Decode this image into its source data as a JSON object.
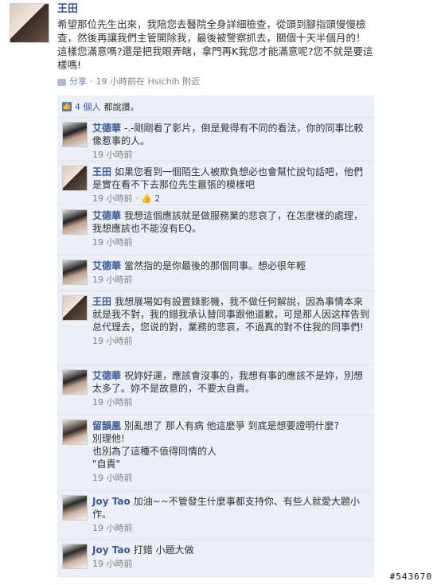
{
  "post": {
    "author": "王田",
    "text": "希望那位先生出來，我陪您去醫院全身詳細檢查，從頭到腳指頭慢慢檢查，然後再讓我們主管開除我，最後被警察抓去，關個十天半個月的！這樣您滿意嗎?還是把我眼弄瞎，拿門再K我您才能滿意呢?您不就是要這樣嗎!",
    "share_label": "分享",
    "time": "19 小時前在 Hsichih 附近"
  },
  "likes": {
    "count_text": "4 個人",
    "suffix": "都說讚。"
  },
  "comments": [
    {
      "author": "艾德華",
      "text": "-.-剛剛看了影片，倒是覺得有不同的看法，你的同事比較像惹事的人。",
      "time": "19 小時前"
    },
    {
      "author": "王田",
      "text": "如果您看到一個陌生人被欺負想必也會幫忙說句話吧，他們是實在看不下去那位先生囂張的模樣吧",
      "time": "19 小時前",
      "likes": "2"
    },
    {
      "author": "艾德華",
      "text": "我想這個應該就是做服務業的悲哀了，在怎麼樣的處理，我想應該也不能沒有EQ。",
      "time": "19 小時前"
    },
    {
      "author": "艾德華",
      "text": "當然指的是你最後的那個同事。想必很年輕",
      "time": "19 小時前"
    },
    {
      "author": "王田",
      "text": "我想展場如有設置錄影機，我不做任何解說，因為事情本來就是我不對，我的錯我承认替同事跟他道歉，可是那人因这样告到总代理去，您说的對，業務的悲哀，不過真的對不住我的同事們!",
      "time": "19 小時前"
    },
    {
      "author": "艾德華",
      "text": "祝妳好運，應該會沒事的，我想有事的應該不是妳，別想太多了。妳不是故意的，不要太自責。",
      "time": "19 小時前"
    },
    {
      "author": "留韻凰",
      "text": "別亂想了 那人有病 他這麼爭 到底是想要證明什麼?\n別理他!\n也別為了這種不值得同情的人\n\"自責\"",
      "time": "19 小時前"
    },
    {
      "author": "Joy Tao",
      "text": "加油~~不管發生什麼事都支持你、有些人就愛大題小作。",
      "time": "19 小時前"
    },
    {
      "author": "Joy Tao",
      "text": "打錯 小題大做",
      "time": "19 小時前"
    }
  ],
  "watermark": "#543670"
}
